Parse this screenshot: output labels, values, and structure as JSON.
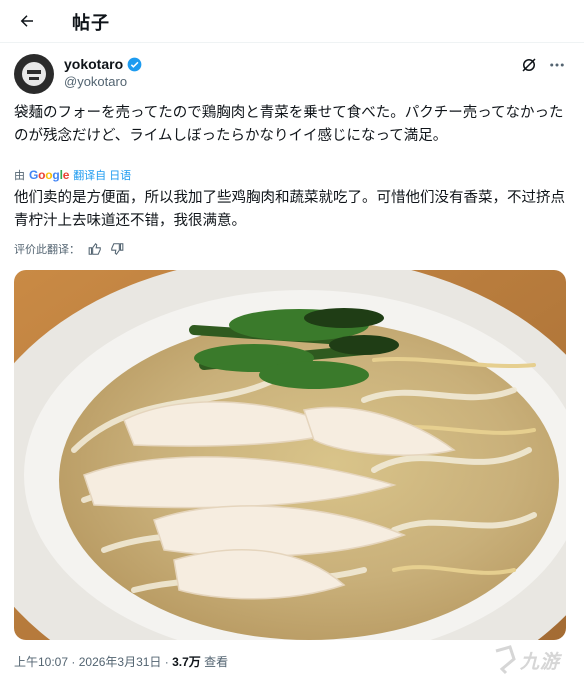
{
  "header": {
    "title": "帖子"
  },
  "author": {
    "display_name": "yokotaro",
    "handle": "@yokotaro"
  },
  "post": {
    "text": "袋麺のフォーを売ってたので鶏胸肉と青菜を乗せて食べた。パクチー売ってなかったのが残念だけど、ライムしぼったらかなりイイ感じになって満足。",
    "translation_prefix": "由",
    "translation_provider": "Google",
    "translation_link": "翻译自 日语",
    "translated_text": "他们卖的是方便面，所以我加了些鸡胸肉和蔬菜就吃了。可惜他们没有香菜，不过挤点青柠汁上去味道还不错，我很满意。",
    "rate_label": "评价此翻译："
  },
  "meta": {
    "time": "上午10:07",
    "separator": "·",
    "date": "2026年3月31日",
    "views": "3.7万",
    "views_label": "查看"
  },
  "watermark": {
    "text": "九游"
  },
  "icons": {
    "back": "arrow-left-icon",
    "verified": "verified-badge-icon",
    "grok": "grok-icon",
    "more": "more-dots-icon",
    "thumb_up": "thumb-up-icon",
    "thumb_down": "thumb-down-icon"
  },
  "colors": {
    "accent": "#1d9bf0",
    "text": "#0f1419",
    "muted": "#536471"
  }
}
